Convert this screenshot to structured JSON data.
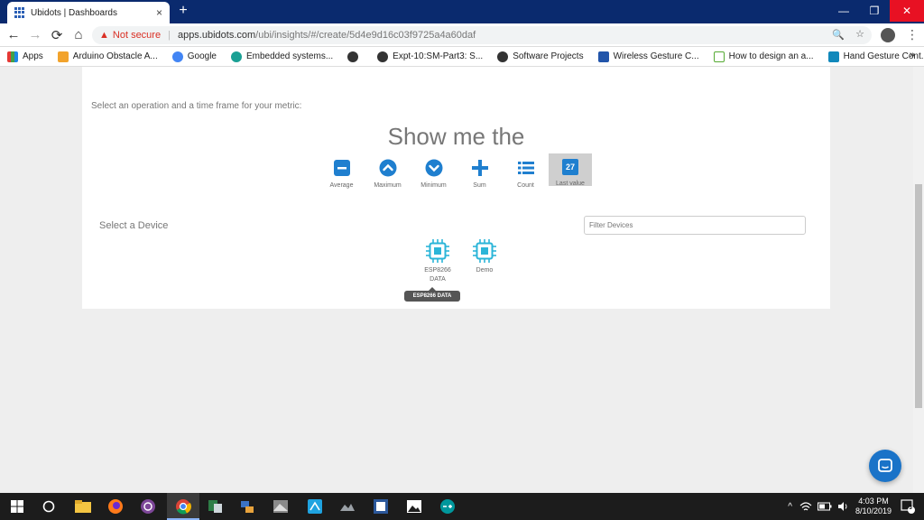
{
  "browser": {
    "tab_title": "Ubidots | Dashboards",
    "tab_close": "×",
    "new_tab": "+",
    "window_controls": {
      "minimize": "—",
      "restore": "❐",
      "close": "✕"
    },
    "nav": {
      "back": "←",
      "forward": "→",
      "reload": "⟳",
      "home": "⌂"
    },
    "security_icon": "▲",
    "security_label": "Not secure",
    "url_host": "apps.ubidots.com",
    "url_path": "/ubi/insights/#/create/5d4e9d16c03f9725a4a60daf",
    "zoom_icon": "🔍",
    "star_icon": "☆",
    "menu_icon": "⋮"
  },
  "bookmarks": {
    "items": [
      {
        "label": "Apps",
        "color": "#e53935"
      },
      {
        "label": "Arduino Obstacle A...",
        "color": "#f2a32c"
      },
      {
        "label": "Google",
        "color": "#4285f4"
      },
      {
        "label": "Embedded systems...",
        "color": "#1aa094"
      },
      {
        "label": "",
        "color": "#333333"
      },
      {
        "label": "Expt-10:SM-Part3: S...",
        "color": "#333333"
      },
      {
        "label": "Software Projects",
        "color": "#333333"
      },
      {
        "label": "Wireless Gesture C...",
        "color": "#2255aa"
      },
      {
        "label": "How to design an a...",
        "color": "#55aa33"
      },
      {
        "label": "Hand Gesture Cont...",
        "color": "#1188bb"
      }
    ],
    "more": "»"
  },
  "main": {
    "instruction": "Select an operation and a time frame for your metric:",
    "headline": "Show me the",
    "accent_color": "#1f7fcf",
    "operations": [
      {
        "label": "Average",
        "icon": "minus-square-icon"
      },
      {
        "label": "Maximum",
        "icon": "chevron-up-circle-icon"
      },
      {
        "label": "Minimum",
        "icon": "chevron-down-circle-icon"
      },
      {
        "label": "Sum",
        "icon": "plus-icon"
      },
      {
        "label": "Count",
        "icon": "list-icon"
      },
      {
        "label": "Last value",
        "icon": "last-value-icon",
        "value": "27",
        "selected": true
      }
    ],
    "select_device_label": "Select a Device",
    "filter_placeholder": "Filter Devices",
    "devices": [
      {
        "label_line1": "ESP8266",
        "label_line2": "DATA"
      },
      {
        "label_line1": "Demo",
        "label_line2": ""
      }
    ],
    "tooltip": "ESP8266 DATA"
  },
  "taskbar": {
    "time": "4:03 PM",
    "date": "8/10/2019",
    "notification_count": "3",
    "tray_chevron": "^"
  }
}
